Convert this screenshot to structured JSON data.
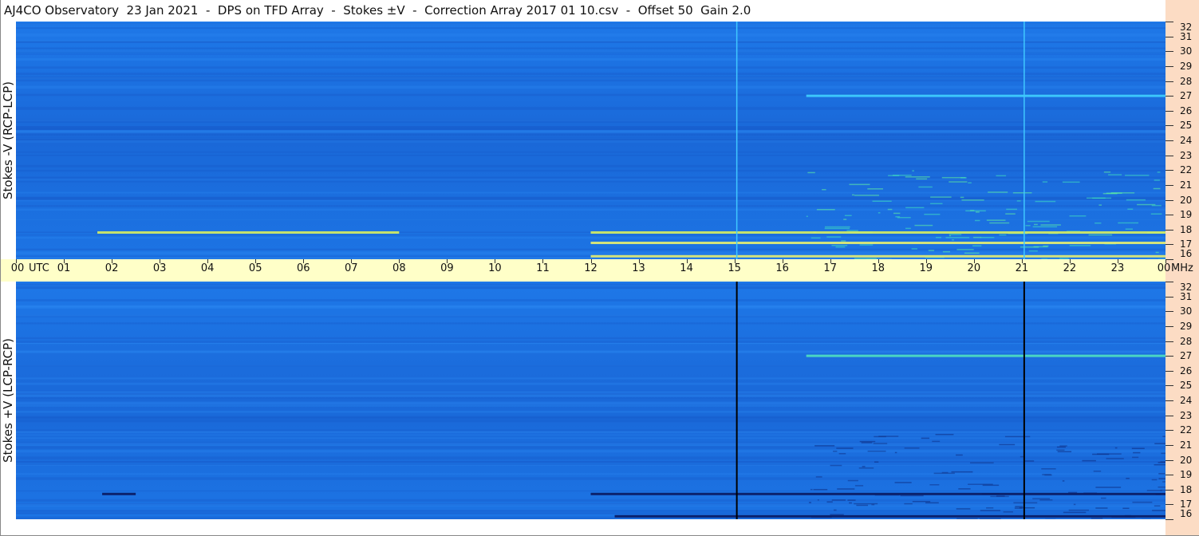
{
  "title": "AJ4CO Observatory  23 Jan 2021  -  DPS on TFD Array  -  Stokes ±V  -  Correction Array 2017 01 10.csv  -  Offset 50  Gain 2.0",
  "chart_data": {
    "type": "heatmap",
    "title": "AJ4CO Observatory  23 Jan 2021  -  DPS on TFD Array  -  Stokes ±V  -  Correction Array 2017 01 10.csv  -  Offset 50  Gain 2.0",
    "xlabel": "UTC",
    "ylabel_units": "MHz",
    "x_ticks": [
      "00",
      "01",
      "02",
      "03",
      "04",
      "05",
      "06",
      "07",
      "08",
      "09",
      "10",
      "11",
      "12",
      "13",
      "14",
      "15",
      "16",
      "17",
      "18",
      "19",
      "20",
      "21",
      "22",
      "23",
      "00"
    ],
    "y_ticks": [
      32,
      31,
      30,
      29,
      28,
      27,
      26,
      25,
      24,
      23,
      22,
      21,
      20,
      19,
      18,
      17,
      16
    ],
    "ylim": [
      16,
      32
    ],
    "xlim_hours": [
      0,
      24
    ],
    "panels": [
      {
        "name": "Stokes -V (RCP-LCP)",
        "colormap": "blue-cyan-yellow",
        "background": "#1a6fe0"
      },
      {
        "name": "Stokes +V (LCP-RCP)",
        "colormap": "blue-cyan-yellow",
        "background": "#1a6fe0"
      }
    ],
    "vertical_markers_hours": [
      15.05,
      21.05
    ],
    "features": [
      {
        "panel": 0,
        "freq_mhz": 17.8,
        "start_hour": 1.7,
        "end_hour": 8.0,
        "color": "#d8f060"
      },
      {
        "panel": 0,
        "freq_mhz": 17.8,
        "start_hour": 12.0,
        "end_hour": 24.0,
        "color": "#d8f060"
      },
      {
        "panel": 0,
        "freq_mhz": 17.1,
        "start_hour": 12.0,
        "end_hour": 24.0,
        "color": "#e8f070"
      },
      {
        "panel": 0,
        "freq_mhz": 16.2,
        "start_hour": 12.0,
        "end_hour": 24.0,
        "color": "#e8f070"
      },
      {
        "panel": 0,
        "freq_mhz": 27.0,
        "start_hour": 16.5,
        "end_hour": 24.0,
        "color": "#40d0ff"
      },
      {
        "panel": 1,
        "freq_mhz": 17.7,
        "start_hour": 1.8,
        "end_hour": 2.5,
        "color": "#0a1a60"
      },
      {
        "panel": 1,
        "freq_mhz": 17.7,
        "start_hour": 12.0,
        "end_hour": 24.0,
        "color": "#0a1a60"
      },
      {
        "panel": 1,
        "freq_mhz": 16.2,
        "start_hour": 12.5,
        "end_hour": 24.0,
        "color": "#0a1a60"
      },
      {
        "panel": 1,
        "freq_mhz": 27.0,
        "start_hour": 16.5,
        "end_hour": 24.0,
        "color": "#50e0c0"
      }
    ]
  },
  "labels": {
    "panel_top": "Stokes -V (RCP-LCP)",
    "panel_bottom": "Stokes +V (LCP-RCP)",
    "utc": "UTC",
    "mhz": "MHz"
  },
  "colors": {
    "time_axis_bg": "#ffffc8",
    "freq_axis_bg": "#fcdcc4",
    "marker_top": "#40c8ff",
    "marker_bottom": "#000000"
  }
}
